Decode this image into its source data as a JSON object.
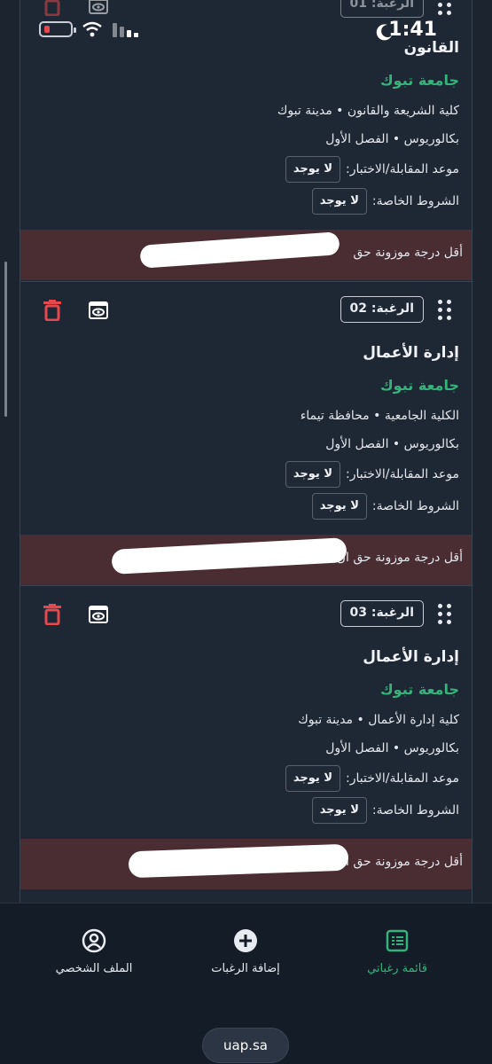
{
  "status_bar": {
    "time": "1:41"
  },
  "cards": [
    {
      "badge": "الرغبة: 01",
      "title": "القانون",
      "university": "جامعة تبوك",
      "college_line": "كلية الشريعة والقانون • مدينة تبوك",
      "degree_line": "بكالوريوس • الفصل الأول",
      "interview_label": "موعد المقابلة/الاختبار:",
      "interview_value": "لا يوجد",
      "conditions_label": "الشروط الخاصة:",
      "conditions_value": "لا يوجد",
      "min_score_text": "أقل درجة موزونة حق"
    },
    {
      "badge": "الرغبة: 02",
      "title": "إدارة الأعمال",
      "university": "جامعة تبوك",
      "college_line": "الكلية الجامعية • محافظة تيماء",
      "degree_line": "بكالوريوس • الفصل الأول",
      "interview_label": "موعد المقابلة/الاختبار:",
      "interview_value": "لا يوجد",
      "conditions_label": "الشروط الخاصة:",
      "conditions_value": "لا يوجد",
      "min_score_text": "أقل درجة موزونة حق ال"
    },
    {
      "badge": "الرغبة: 03",
      "title": "إدارة الأعمال",
      "university": "جامعة تبوك",
      "college_line": "كلية إدارة الأعمال • مدينة تبوك",
      "degree_line": "بكالوريوس • الفصل الأول",
      "interview_label": "موعد المقابلة/الاختبار:",
      "interview_value": "لا يوجد",
      "conditions_label": "الشروط الخاصة:",
      "conditions_value": "لا يوجد",
      "min_score_text": "أقل درجة موزونة حق ا"
    }
  ],
  "bottom_nav": {
    "items": [
      {
        "label": "قائمة رغباتي",
        "icon": "list-icon",
        "active": true
      },
      {
        "label": "إضافة الرغبات",
        "icon": "add-circle-icon",
        "active": false
      },
      {
        "label": "الملف الشخصي",
        "icon": "profile-icon",
        "active": false
      }
    ],
    "url": "uap.sa"
  },
  "colors": {
    "accent": "#35b37a",
    "danger": "#e5484d",
    "band": "#4a2c33",
    "background": "#1e2734"
  }
}
